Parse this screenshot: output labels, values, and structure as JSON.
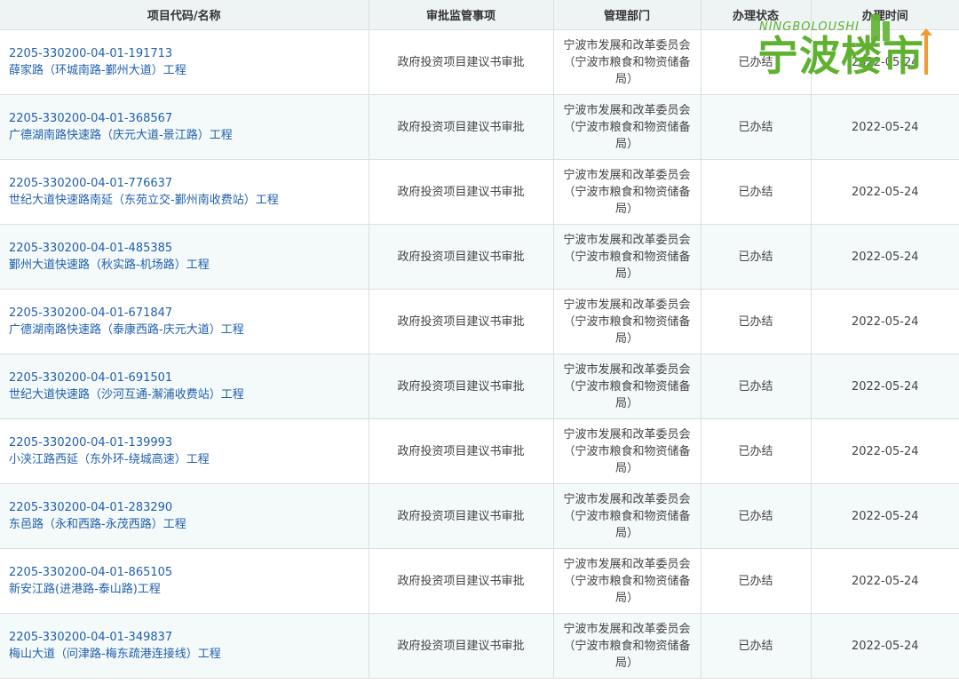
{
  "table": {
    "headers": [
      "项目代码/名称",
      "审批监管事项",
      "管理部门",
      "办理状态",
      "办理时间"
    ],
    "rows": [
      {
        "code": "2205-330200-04-01-191713",
        "name": "薛家路（环城南路-鄞州大道）工程",
        "matter": "政府投资项目建议书审批",
        "dept": [
          "宁波市发展和改革委员会",
          "（宁波市粮食和物资储备",
          "局）"
        ],
        "status": "已办结",
        "date": "2022-05-24"
      },
      {
        "code": "2205-330200-04-01-368567",
        "name": "广德湖南路快速路（庆元大道-景江路）工程",
        "matter": "政府投资项目建议书审批",
        "dept": [
          "宁波市发展和改革委员会",
          "（宁波市粮食和物资储备",
          "局）"
        ],
        "status": "已办结",
        "date": "2022-05-24"
      },
      {
        "code": "2205-330200-04-01-776637",
        "name": "世纪大道快速路南延（东苑立交-鄞州南收费站）工程",
        "matter": "政府投资项目建议书审批",
        "dept": [
          "宁波市发展和改革委员会",
          "（宁波市粮食和物资储备",
          "局）"
        ],
        "status": "已办结",
        "date": "2022-05-24"
      },
      {
        "code": "2205-330200-04-01-485385",
        "name": "鄞州大道快速路（秋实路-机场路）工程",
        "matter": "政府投资项目建议书审批",
        "dept": [
          "宁波市发展和改革委员会",
          "（宁波市粮食和物资储备",
          "局）"
        ],
        "status": "已办结",
        "date": "2022-05-24"
      },
      {
        "code": "2205-330200-04-01-671847",
        "name": "广德湖南路快速路（泰康西路-庆元大道）工程",
        "matter": "政府投资项目建议书审批",
        "dept": [
          "宁波市发展和改革委员会",
          "（宁波市粮食和物资储备",
          "局）"
        ],
        "status": "已办结",
        "date": "2022-05-24"
      },
      {
        "code": "2205-330200-04-01-691501",
        "name": "世纪大道快速路（沙河互通-澥浦收费站）工程",
        "matter": "政府投资项目建议书审批",
        "dept": [
          "宁波市发展和改革委员会",
          "（宁波市粮食和物资储备",
          "局）"
        ],
        "status": "已办结",
        "date": "2022-05-24"
      },
      {
        "code": "2205-330200-04-01-139993",
        "name": "小浃江路西延（东外环-绕城高速）工程",
        "matter": "政府投资项目建议书审批",
        "dept": [
          "宁波市发展和改革委员会",
          "（宁波市粮食和物资储备",
          "局）"
        ],
        "status": "已办结",
        "date": "2022-05-24"
      },
      {
        "code": "2205-330200-04-01-283290",
        "name": "东邑路（永和西路-永茂西路）工程",
        "matter": "政府投资项目建议书审批",
        "dept": [
          "宁波市发展和改革委员会",
          "（宁波市粮食和物资储备",
          "局）"
        ],
        "status": "已办结",
        "date": "2022-05-24"
      },
      {
        "code": "2205-330200-04-01-865105",
        "name": "新安江路(进港路-泰山路)工程",
        "matter": "政府投资项目建议书审批",
        "dept": [
          "宁波市发展和改革委员会",
          "（宁波市粮食和物资储备",
          "局）"
        ],
        "status": "已办结",
        "date": "2022-05-24"
      },
      {
        "code": "2205-330200-04-01-349837",
        "name": "梅山大道（问津路-梅东疏港连接线）工程",
        "matter": "政府投资项目建议书审批",
        "dept": [
          "宁波市发展和改革委员会",
          "（宁波市粮食和物资储备",
          "局）"
        ],
        "status": "已办结",
        "date": "2022-05-24"
      }
    ]
  },
  "watermark": {
    "en": "NINGBOLOUSHI",
    "cn": "宁波楼市",
    "color": "#5fb230"
  },
  "colors": {
    "link": "#2160ad",
    "header_bg": "#eef4f4",
    "row_alt_bg": "#f4f9f9",
    "border": "#d9dfe3"
  }
}
